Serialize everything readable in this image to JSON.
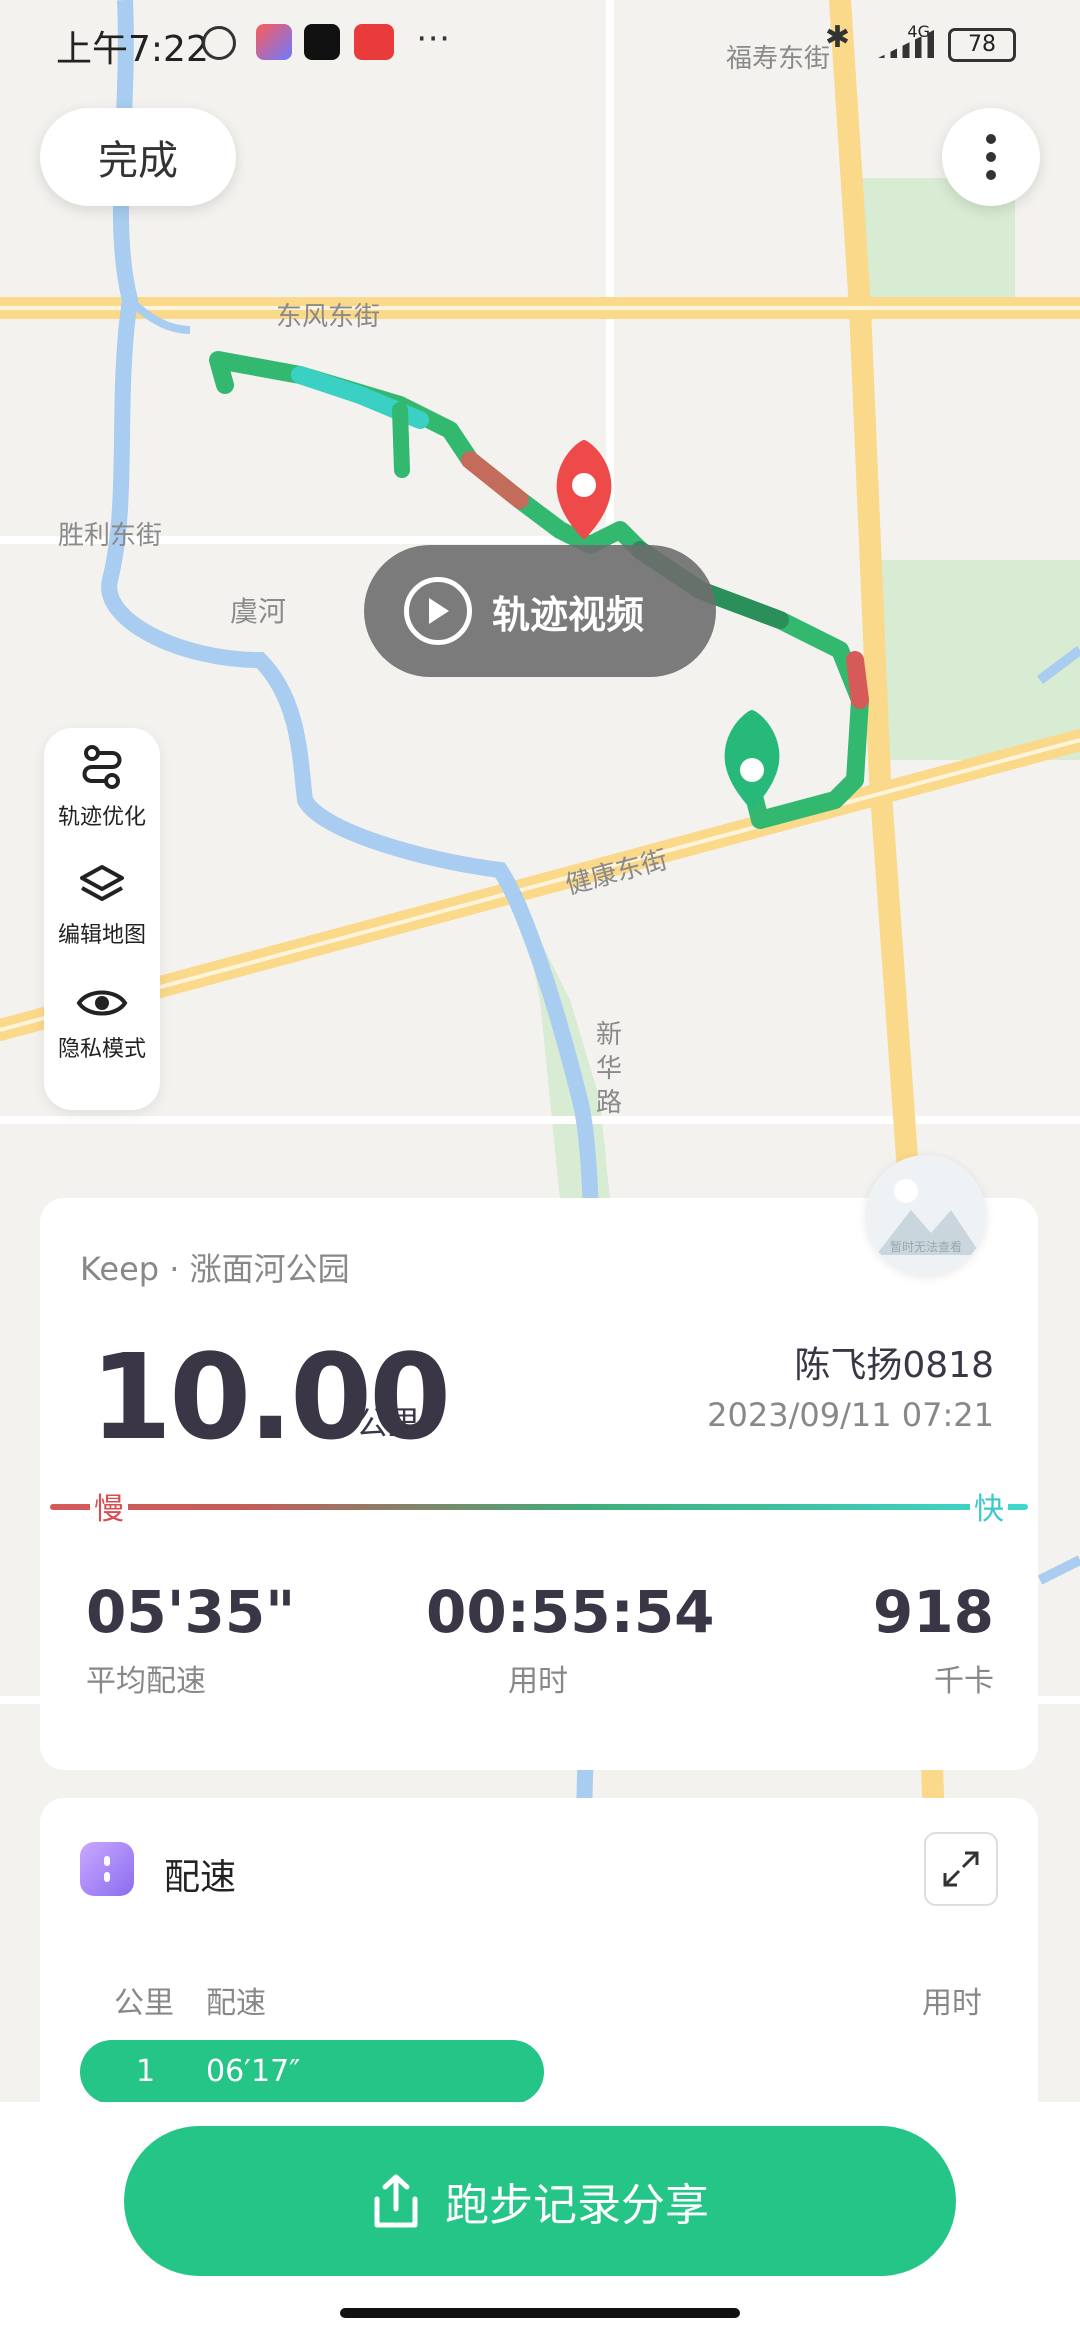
{
  "status_bar": {
    "time": "上午7:22",
    "network": "4G",
    "battery": "78"
  },
  "header": {
    "done_label": "完成"
  },
  "map": {
    "labels": {
      "fushou": "福寿东街",
      "dongfeng": "东风东街",
      "shengli": "胜利东街",
      "yuhe": "虞河",
      "jiankang": "健康东街",
      "xinhua": "新华路"
    },
    "track_video_label": "轨迹视频"
  },
  "tools": [
    {
      "label": "轨迹优化",
      "icon": "track-optimize-icon"
    },
    {
      "label": "编辑地图",
      "icon": "layers-icon"
    },
    {
      "label": "隐私模式",
      "icon": "eye-icon"
    }
  ],
  "thumbnail": {
    "text": "暂时无法查看"
  },
  "summary": {
    "source": "Keep · 涨面河公园",
    "distance": "10.00",
    "distance_unit": "公里",
    "user": "陈飞扬0818",
    "datetime": "2023/09/11 07:21",
    "slow_label": "慢",
    "fast_label": "快",
    "stats": [
      {
        "value": "05'35\"",
        "label": "平均配速"
      },
      {
        "value": "00:55:54",
        "label": "用时"
      },
      {
        "value": "918",
        "label": "千卡"
      }
    ]
  },
  "pace": {
    "title": "配速",
    "columns": {
      "km": "公里",
      "pace": "配速",
      "time": "用时"
    },
    "rows": [
      {
        "km": "1",
        "pace": "06′17″"
      }
    ]
  },
  "share": {
    "label": "跑步记录分享"
  },
  "colors": {
    "accent": "#24c586",
    "slow": "#d94c50",
    "fast": "#3cc8cd"
  }
}
